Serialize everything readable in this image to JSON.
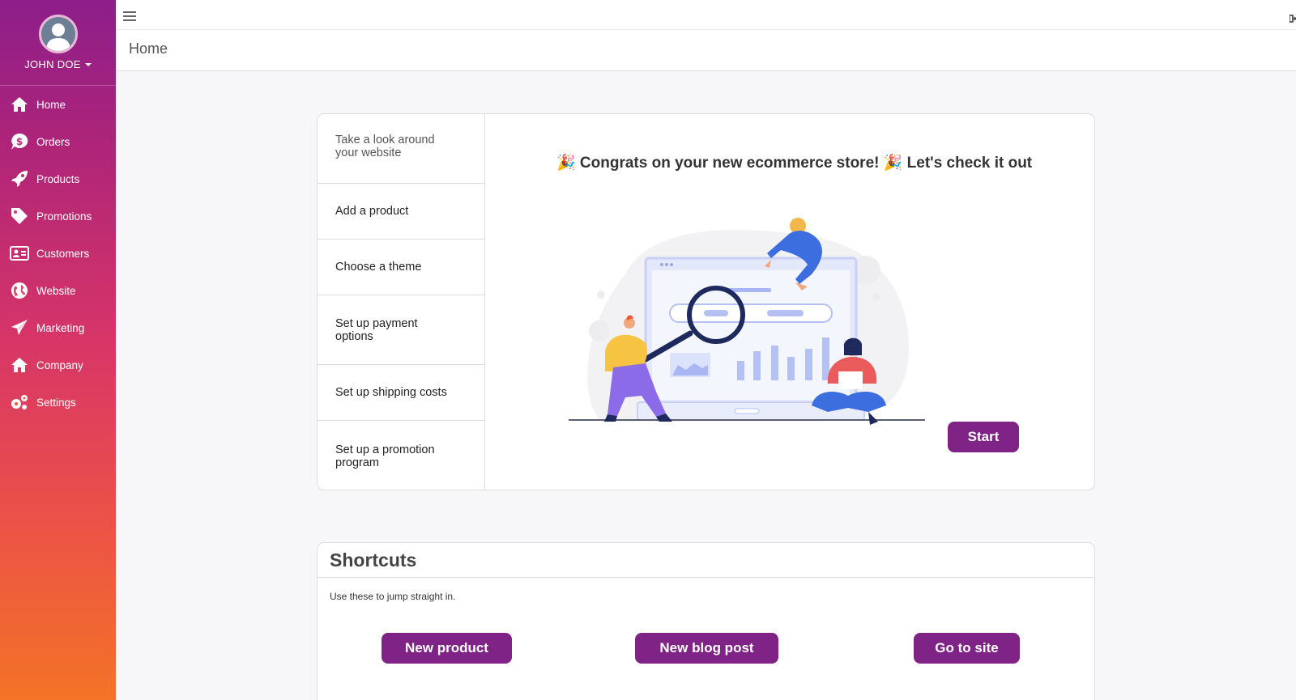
{
  "user": {
    "name": "JOHN DOE"
  },
  "sidebar": {
    "items": [
      {
        "label": "Home",
        "icon": "home-icon"
      },
      {
        "label": "Orders",
        "icon": "dollar-bubble-icon"
      },
      {
        "label": "Products",
        "icon": "rocket-icon"
      },
      {
        "label": "Promotions",
        "icon": "tag-icon"
      },
      {
        "label": "Customers",
        "icon": "address-card-icon"
      },
      {
        "label": "Website",
        "icon": "globe-icon"
      },
      {
        "label": "Marketing",
        "icon": "paper-plane-icon"
      },
      {
        "label": "Company",
        "icon": "home-icon"
      },
      {
        "label": "Settings",
        "icon": "gears-icon"
      }
    ]
  },
  "breadcrumb": "Home",
  "onboarding": {
    "steps": [
      "Take a look around your website",
      "Add a product",
      "Choose a theme",
      "Set up payment options",
      "Set up shipping costs",
      "Set up a promotion program"
    ],
    "headline": "🎉 Congrats on your new ecommerce store! 🎉 Let's check it out",
    "start_label": "Start"
  },
  "shortcuts": {
    "title": "Shortcuts",
    "subtitle": "Use these to jump straight in.",
    "buttons": [
      "New product",
      "New blog post",
      "Go to site"
    ]
  },
  "colors": {
    "accent": "#7f2386",
    "sidebar_top": "#8d1e8a",
    "sidebar_bottom": "#f47326"
  }
}
